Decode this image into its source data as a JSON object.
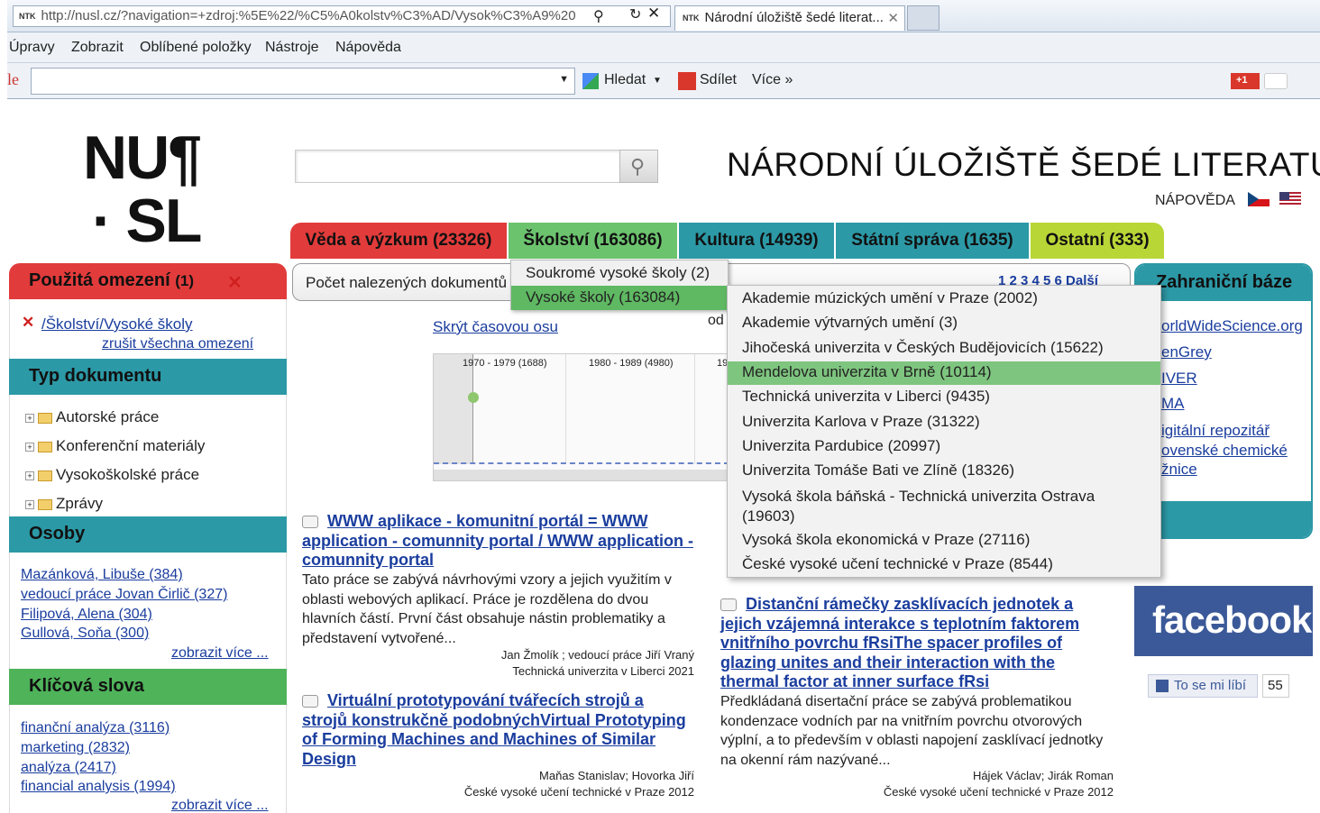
{
  "browser": {
    "url": "http://nusl.cz/?navigation=+zdroj:%5E%22/%C5%A0kolstv%C3%AD/Vysok%C3%A9%20",
    "tab_title": "Národní úložiště šedé literat...",
    "favicon_text": "NTK",
    "menu": [
      "Úpravy",
      "Zobrazit",
      "Oblíbené položky",
      "Nástroje",
      "Nápověda"
    ],
    "toolbar": {
      "search_left": "le",
      "search_label": "Hledat",
      "share_label": "Sdílet",
      "more_label": "Více »",
      "gplus": "+1"
    }
  },
  "site": {
    "logo_line1": "NU¶",
    "logo_line2": "· SL",
    "title": "NÁRODNÍ ÚLOŽIŠTĚ ŠEDÉ LITERATURY",
    "help": "NÁPOVĚDA",
    "search_value": ""
  },
  "nav_tabs": [
    {
      "label": "Věda a výzkum (23326)",
      "color": "#e23b3b"
    },
    {
      "label": "Školství (163086)",
      "color": "#6cc36e"
    },
    {
      "label": "Kultura (14939)",
      "color": "#2c99a6"
    },
    {
      "label": "Státní správa (1635)",
      "color": "#2c99a6"
    },
    {
      "label": "Ostatní (333)",
      "color": "#b9d637"
    }
  ],
  "left": {
    "applied": {
      "title": "Použitá omezení",
      "count": "(1)",
      "remove": "✕",
      "item": "/Školství/Vysoké školy",
      "clear_all": "zrušit všechna omezení"
    },
    "doc_type": {
      "title": "Typ dokumentu",
      "items": [
        "Autorské práce",
        "Konferenční materiály",
        "Vysokoškolské práce",
        "Zprávy"
      ]
    },
    "persons": {
      "title": "Osoby",
      "items": [
        "Mazánková, Libuše (384)",
        "vedoucí práce Jovan Čirlič (327)",
        "Filipová, Alena (304)",
        "Gullová, Soňa (300)"
      ],
      "more": "zobrazit více ..."
    },
    "keywords": {
      "title": "Klíčová slova",
      "items": [
        "finanční analýza (3116)",
        "marketing (2832)",
        "analýza (2417)",
        "financial analysis (1994)"
      ],
      "more": "zobrazit více ..."
    }
  },
  "center": {
    "count_label": "Počet nalezených dokumentů",
    "pager": "1 2 3 4 5 6  Další",
    "hide_timeline": "Skrýt časovou osu",
    "od": "od",
    "timeline": [
      "1970 - 1979 (1688)",
      "1980 - 1989 (4980)",
      "19"
    ],
    "results": [
      {
        "title": "WWW aplikace - komunitní portál = WWW application - comunnity portal / WWW application - comunnity portal",
        "desc": "Tato práce se zabývá návrhovými vzory a jejich využitím v oblasti webových aplikací. Práce je rozdělena do dvou hlavních částí. První část obsahuje nástin problematiky a představení vytvořené...",
        "authors": "Jan Žmolík ; vedoucí práce Jiří Vraný",
        "source": "Technická univerzita v Liberci 2021"
      },
      {
        "title": "Virtuální prototypování tvářecích strojů a strojů konstrukčně podobnýchVirtual Prototyping of Forming Machines and Machines of Similar Design",
        "desc": "",
        "authors": "Maňas Stanislav; Hovorka Jiří",
        "source": "České vysoké učení technické v Praze 2012"
      },
      {
        "title": "Distanční rámečky zasklívacích jednotek a jejich vzájemná interakce s teplotním faktorem vnitřního povrchu fRsiThe spacer profiles of glazing unites and their interaction with the thermal factor at inner surface fRsi",
        "desc": "Předkládaná disertační práce se zabývá problematikou kondenzace vodních par na vnitřním povrchu otvorových výplní, a to především v oblasti napojení zasklívací jednotky na okenní rám nazývané...",
        "authors": "Hájek Václav; Jirák Roman",
        "source": "České vysoké učení technické v Praze 2012"
      }
    ]
  },
  "dropdown1": [
    "Soukromé vysoké školy (2)",
    "Vysoké školy (163084)"
  ],
  "dropdown2": [
    "Akademie múzických umění v Praze (2002)",
    "Akademie výtvarných umění (3)",
    "Jihočeská univerzita v Českých Budějovicích (15622)",
    "Mendelova univerzita v Brně (10114)",
    "Technická univerzita v Liberci (9435)",
    "Univerzita Karlova v Praze (31322)",
    "Univerzita Pardubice (20997)",
    "Univerzita Tomáše Bati ve Zlíně (18326)",
    "Vysoká škola báňská - Technická univerzita Ostrava (19603)",
    "Vysoká škola ekonomická v Praze (27116)",
    "České vysoké učení technické v Praze (8544)"
  ],
  "right": {
    "title": "Zahraniční báze",
    "links": [
      "orldWideScience.org",
      "enGrey",
      "IVER",
      "MA",
      "igitální repozitář",
      "ovenské chemické",
      "žnice"
    ],
    "facebook": "facebook",
    "like": "To se mi líbí",
    "like_count": "55"
  }
}
